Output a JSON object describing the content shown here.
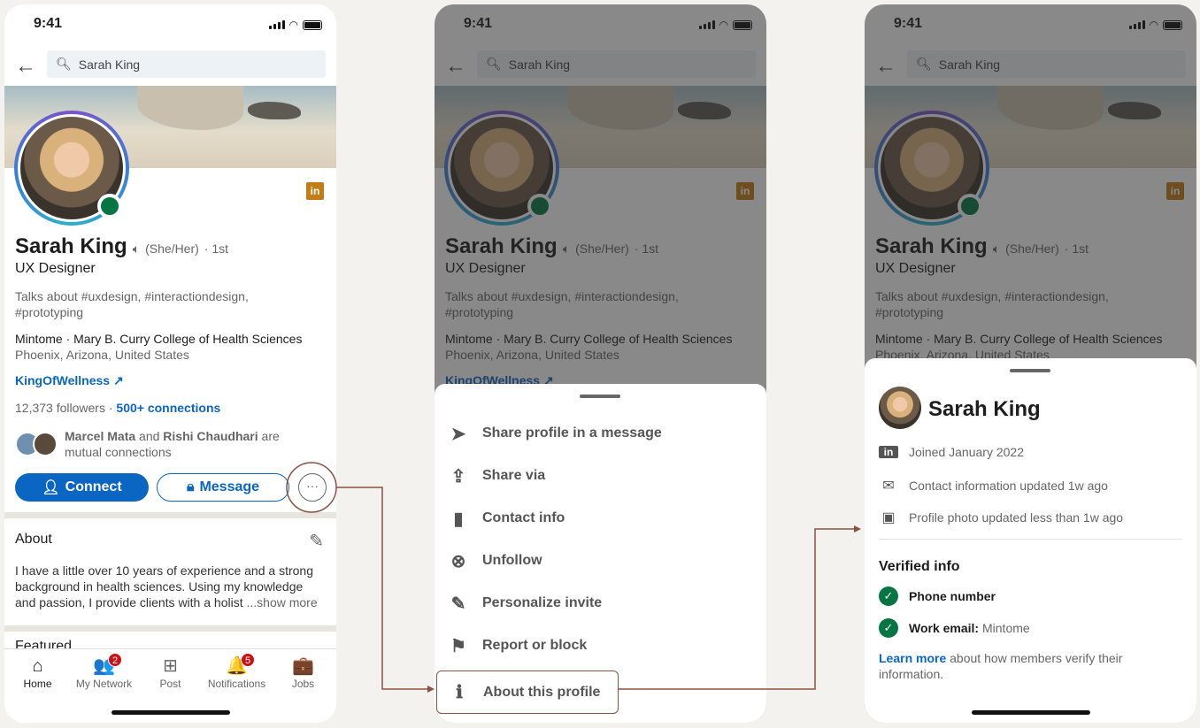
{
  "status": {
    "time": "9:41"
  },
  "search": {
    "value": "Sarah King"
  },
  "profile": {
    "name": "Sarah King",
    "pronouns": "(She/Her)",
    "degree": "· 1st",
    "headline": "UX Designer",
    "talks": "Talks about #uxdesign, #interactiondesign, #prototyping",
    "company": "Mintome · Mary B. Curry College of Health Sciences",
    "location": "Phoenix, Arizona, United States",
    "website": "KingOfWellness",
    "followers": "12,373 followers ·",
    "connections": "500+ connections",
    "mutual_1": "Marcel Mata",
    "mutual_and": "and",
    "mutual_2": "Rishi Chaudhari",
    "mutual_tail": "are mutual connections",
    "connect_label": "Connect",
    "message_label": "Message",
    "more_label": "···",
    "linkedin_badge": "in"
  },
  "about": {
    "title": "About",
    "text": "I have a little over 10 years of experience and a strong background in health sciences. Using my knowledge and passion, I provide clients with a holist",
    "more": "...show more",
    "next_section": "Featured"
  },
  "nav": [
    {
      "label": "Home",
      "icon": "home-icon",
      "glyph": "⌂"
    },
    {
      "label": "My Network",
      "icon": "people-icon",
      "glyph": "👥",
      "badge": "2"
    },
    {
      "label": "Post",
      "icon": "plus-square-icon",
      "glyph": "⊞"
    },
    {
      "label": "Notifications",
      "icon": "bell-icon",
      "glyph": "🔔",
      "badge": "5"
    },
    {
      "label": "Jobs",
      "icon": "briefcase-icon",
      "glyph": "💼"
    }
  ],
  "menu": [
    {
      "label": "Share profile in a message",
      "icon": "send-icon",
      "glyph": "➤"
    },
    {
      "label": "Share via",
      "icon": "share-icon",
      "glyph": "⇪"
    },
    {
      "label": "Contact info",
      "icon": "contact-book-icon",
      "glyph": "▮"
    },
    {
      "label": "Unfollow",
      "icon": "x-circle-icon",
      "glyph": "⊗"
    },
    {
      "label": "Personalize invite",
      "icon": "edit-icon",
      "glyph": "✎"
    },
    {
      "label": "Report or block",
      "icon": "flag-icon",
      "glyph": "⚑"
    },
    {
      "label": "About this profile",
      "icon": "info-icon",
      "glyph": "ℹ"
    }
  ],
  "about_profile": {
    "name": "Sarah King",
    "rows": [
      {
        "text": "Joined January 2022",
        "icon": "linkedin-icon",
        "glyph": "in"
      },
      {
        "text": "Contact information updated 1w ago",
        "icon": "mail-icon",
        "glyph": "✉"
      },
      {
        "text": "Profile photo updated less than 1w ago",
        "icon": "image-icon",
        "glyph": "▣"
      }
    ],
    "verified_title": "Verified info",
    "phone": "Phone number",
    "work_label": "Work email:",
    "work_value": "Mintome",
    "learn_more": "Learn more",
    "learn_tail": "about how members verify their information."
  },
  "colors": {
    "brand": "#0a66c2",
    "online": "#057642",
    "annotation": "#8a5245",
    "badge": "#cc1016"
  }
}
